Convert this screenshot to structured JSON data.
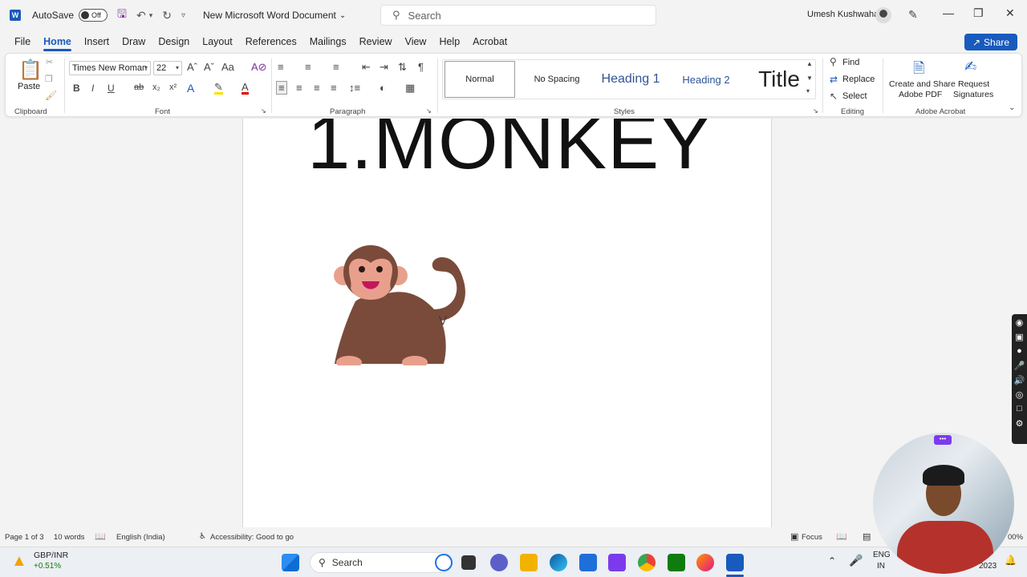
{
  "titlebar": {
    "autosave_label": "AutoSave",
    "autosave_state": "Off",
    "doc_title": "New Microsoft Word Document",
    "search_placeholder": "Search",
    "user_name": "Umesh Kushwaha"
  },
  "tabs": [
    {
      "label": "File"
    },
    {
      "label": "Home"
    },
    {
      "label": "Insert"
    },
    {
      "label": "Draw"
    },
    {
      "label": "Design"
    },
    {
      "label": "Layout"
    },
    {
      "label": "References"
    },
    {
      "label": "Mailings"
    },
    {
      "label": "Review"
    },
    {
      "label": "View"
    },
    {
      "label": "Help"
    },
    {
      "label": "Acrobat"
    }
  ],
  "share_label": "Share",
  "ribbon": {
    "clipboard": {
      "paste": "Paste",
      "label": "Clipboard"
    },
    "font": {
      "name": "Times New Roman",
      "size": "22",
      "label": "Font"
    },
    "paragraph": {
      "label": "Paragraph"
    },
    "styles": {
      "normal": "Normal",
      "nospacing": "No Spacing",
      "h1": "Heading 1",
      "h2": "Heading 2",
      "title": "Title",
      "label": "Styles"
    },
    "editing": {
      "find": "Find",
      "replace": "Replace",
      "select": "Select",
      "label": "Editing"
    },
    "acrobat": {
      "create": "Create and Share",
      "create2": "Adobe PDF",
      "request": "Request",
      "request2": "Signatures",
      "label": "Adobe Acrobat"
    }
  },
  "document": {
    "heading": "1.MONKEY"
  },
  "status": {
    "page": "Page 1 of 3",
    "words": "10 words",
    "language": "English (India)",
    "accessibility": "Accessibility: Good to go",
    "focus": "Focus",
    "zoom": "00%"
  },
  "taskbar": {
    "stock_name": "GBP/INR",
    "stock_change": "+0.51%",
    "search": "Search",
    "lang1": "ENG",
    "lang2": "IN",
    "year": "2023"
  },
  "colors": {
    "accent": "#185abd",
    "heading_style": "#2f5496",
    "monkey_body": "#7a4b3a",
    "monkey_face": "#e8a08c"
  }
}
